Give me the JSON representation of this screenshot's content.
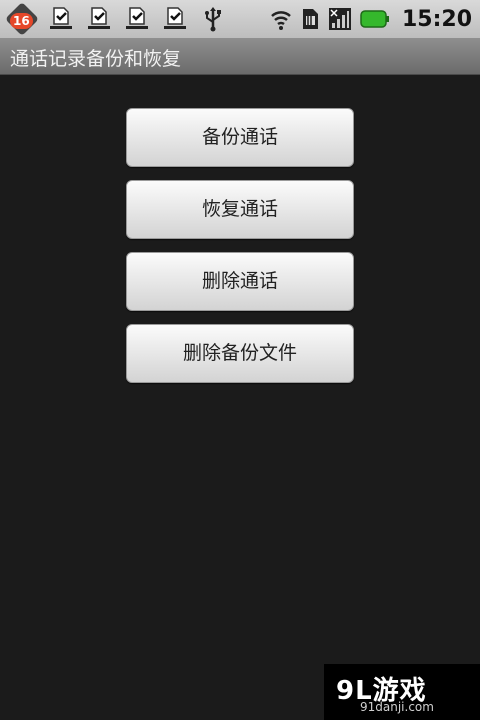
{
  "status_bar": {
    "notification_count": "16",
    "time": "15:20",
    "icons": [
      "android-notify-icon",
      "download-complete-icon",
      "download-complete-icon",
      "download-complete-icon",
      "download-complete-icon",
      "usb-icon",
      "wifi-icon",
      "sim-icon",
      "signal-icon",
      "battery-icon"
    ],
    "battery_color": "#35b82c"
  },
  "app": {
    "title": "通话记录备份和恢复"
  },
  "buttons": {
    "backup": "备份通话",
    "restore": "恢复通话",
    "delete": "删除通话",
    "delete_backup": "删除备份文件"
  },
  "watermark": {
    "logo": "9L游戏",
    "site": "91danji.com"
  }
}
